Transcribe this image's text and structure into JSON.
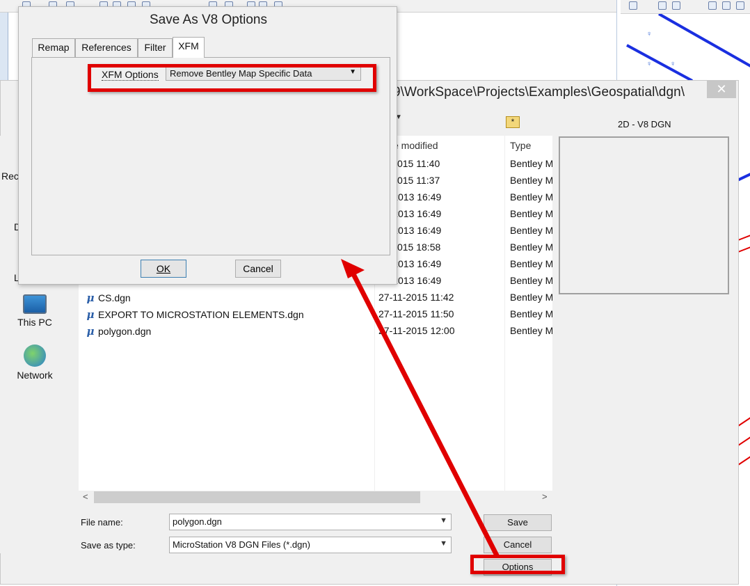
{
  "v8_dialog": {
    "title": "Save As V8 Options",
    "tabs": [
      "Remap",
      "References",
      "Filter",
      "XFM"
    ],
    "active_tab": "XFM",
    "xfm_label": "XFM Options",
    "xfm_value": "Remove Bentley Map Specific Data",
    "ok_label": "OK",
    "cancel_label": "Cancel"
  },
  "save_dialog": {
    "path_fragment": "9\\WorkSpace\\Projects\\Examples\\Geospatial\\dgn\\",
    "close_glyph": "✕",
    "columns": {
      "date": "e modified",
      "type": "Type"
    },
    "rows": [
      {
        "name": "",
        "date": "11-2015 11:40",
        "type": "Bentley M"
      },
      {
        "name": "",
        "date": "11-2015 11:37",
        "type": "Bentley M"
      },
      {
        "name": "",
        "date": "06-2013 16:49",
        "type": "Bentley M"
      },
      {
        "name": "",
        "date": "06-2013 16:49",
        "type": "Bentley M"
      },
      {
        "name": "",
        "date": "06-2013 16:49",
        "type": "Bentley M"
      },
      {
        "name": "",
        "date": "11-2015 18:58",
        "type": "Bentley M"
      },
      {
        "name": "",
        "date": "06-2013 16:49",
        "type": "Bentley M"
      },
      {
        "name": "",
        "date": "06-2013 16:49",
        "type": "Bentley M"
      },
      {
        "name": "CS.dgn",
        "date": "27-11-2015 11:42",
        "type": "Bentley M"
      },
      {
        "name": "EXPORT TO MICROSTATION ELEMENTS.dgn",
        "date": "27-11-2015 11:50",
        "type": "Bentley M"
      },
      {
        "name": "polygon.dgn",
        "date": "27-11-2015 12:00",
        "type": "Bentley M"
      }
    ],
    "nav": {
      "rec": "Rec",
      "d": "D",
      "l": "L",
      "this_pc": "This PC",
      "network": "Network"
    },
    "preview_label": "2D - V8 DGN",
    "file_name_label": "File name:",
    "file_name_value": "polygon.dgn",
    "save_type_label": "Save as type:",
    "save_type_value": "MicroStation V8 DGN Files (*.dgn)",
    "save_label": "Save",
    "cancel_label": "Cancel",
    "options_label": "Options"
  },
  "colors": {
    "highlight": "#e00000",
    "dialog_bg": "#f0f0f0"
  },
  "icons": [
    "file-dgn-icon",
    "new-folder-icon",
    "this-pc-icon",
    "network-icon",
    "close-icon",
    "dropdown-arrow-icon"
  ]
}
